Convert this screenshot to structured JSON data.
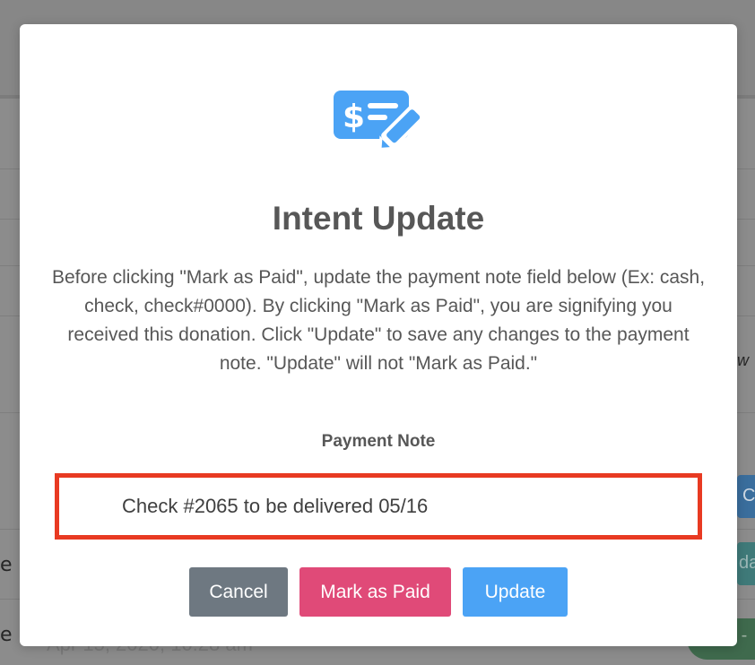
{
  "background": {
    "row_edge_1": "e",
    "row_edge_2": "e",
    "italic_fragment": "w",
    "blue_button_fragment": "Ca",
    "teal_button_fragment": "dat",
    "green_pill_fragment": "d -",
    "date_fragment": "Apr 15, 2020, 10:28 am"
  },
  "modal": {
    "icon": "check-payment-icon",
    "title": "Intent Update",
    "body": "Before clicking \"Mark as Paid\", update the payment note field below (Ex: cash, check, check#0000). By clicking \"Mark as Paid\", you are signifying you received this donation. Click \"Update\" to save any changes to the payment note. \"Update\" will not \"Mark as Paid.\"",
    "field_label": "Payment Note",
    "payment_note_value": "Check #2065 to be delivered 05/16",
    "buttons": {
      "cancel": "Cancel",
      "mark_paid": "Mark as Paid",
      "update": "Update"
    }
  },
  "colors": {
    "icon_blue": "#4ba3f5",
    "highlight_red": "#e83a22",
    "cancel_gray": "#6e7881",
    "mark_paid_pink": "#e04a78",
    "update_blue": "#4ba3f5"
  }
}
